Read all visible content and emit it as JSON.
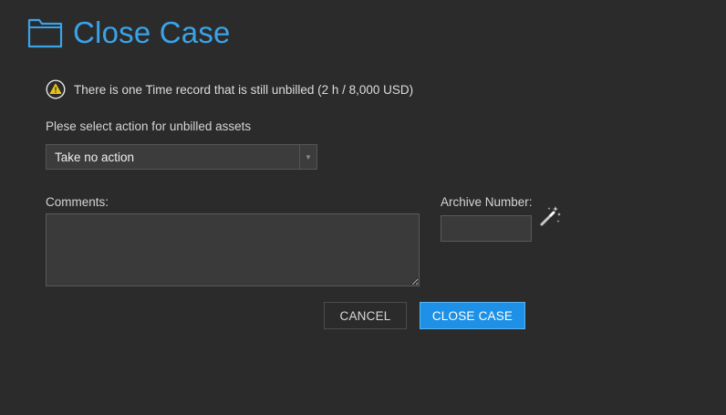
{
  "header": {
    "title": "Close Case",
    "icon": "folder-icon",
    "title_color": "#3aa3e8"
  },
  "warning": {
    "icon": "warning-icon",
    "text": "There is one Time record that is still unbilled (2 h / 8,000 USD)"
  },
  "unbilled_action": {
    "label": "Plese select action for unbilled assets",
    "selected": "Take no action"
  },
  "comments": {
    "label": "Comments:",
    "value": ""
  },
  "archive": {
    "label": "Archive Number:",
    "value": "",
    "generate_icon": "magic-wand-icon"
  },
  "buttons": {
    "cancel": "CANCEL",
    "close_case": "CLOSE CASE",
    "primary_color": "#1e90e6"
  }
}
